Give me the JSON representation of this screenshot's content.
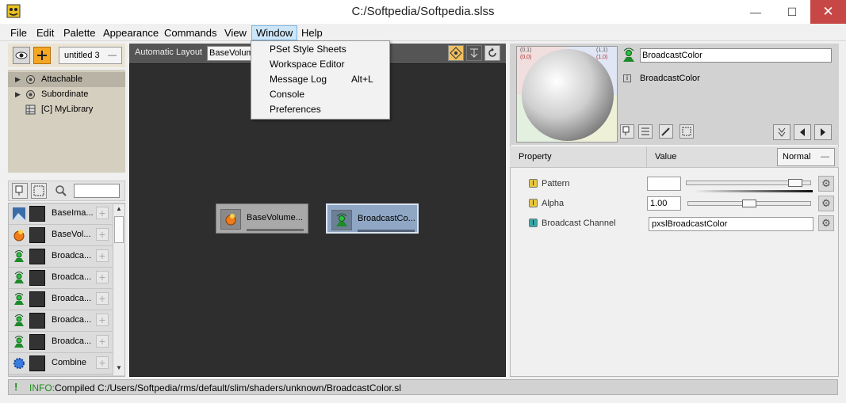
{
  "window": {
    "title": "C:/Softpedia/Softpedia.slss",
    "min_glyph": "—",
    "max_glyph": "☐",
    "close_glyph": "✕"
  },
  "menu": {
    "items": [
      "File",
      "Edit",
      "Palette",
      "Appearance",
      "Commands",
      "View",
      "Window",
      "Help"
    ],
    "active": "Window"
  },
  "window_menu": {
    "items": [
      {
        "label": "PSet Style Sheets",
        "shortcut": ""
      },
      {
        "label": "Workspace Editor",
        "shortcut": ""
      },
      {
        "label": "Message Log",
        "shortcut": "Alt+L"
      },
      {
        "label": "Console",
        "shortcut": ""
      },
      {
        "label": "Preferences",
        "shortcut": ""
      }
    ]
  },
  "left_panel": {
    "palette_select": "untitled 3",
    "tree": [
      {
        "label": "Attachable",
        "expandable": true,
        "selected": true
      },
      {
        "label": "Subordinate",
        "expandable": true,
        "selected": false
      },
      {
        "label": "[C] MyLibrary",
        "expandable": false,
        "selected": false
      }
    ],
    "search_value": "",
    "nodes": [
      {
        "label": "BaseIma...",
        "icon": "image-icon"
      },
      {
        "label": "BaseVol...",
        "icon": "volume-icon"
      },
      {
        "label": "Broadca...",
        "icon": "broadcast-icon"
      },
      {
        "label": "Broadca...",
        "icon": "broadcast-icon"
      },
      {
        "label": "Broadca...",
        "icon": "broadcast-icon"
      },
      {
        "label": "Broadca...",
        "icon": "broadcast-icon"
      },
      {
        "label": "Broadca...",
        "icon": "broadcast-icon"
      },
      {
        "label": "Combine",
        "icon": "combine-icon"
      }
    ]
  },
  "canvas": {
    "layout_label": "Automatic Layout",
    "layout_select": "BaseVolum",
    "nodes": [
      {
        "label": "BaseVolume...",
        "selected": false
      },
      {
        "label": "BroadcastCo...",
        "selected": true
      }
    ]
  },
  "right_panel": {
    "node_name": "BroadcastColor",
    "node_info": "BroadcastColor",
    "preview_corners": [
      "(0,1)",
      "(1,1)",
      "(0,0)",
      "(1,0)"
    ],
    "header": {
      "property": "Property",
      "value": "Value",
      "mode": "Normal"
    },
    "properties": [
      {
        "label": "Pattern",
        "badge": "I",
        "badge_color": "#e8c840",
        "value": "",
        "slider": 0.93
      },
      {
        "label": "Alpha",
        "badge": "I",
        "badge_color": "#e8c840",
        "value": "1.00",
        "slider": 0.5
      },
      {
        "label": "Broadcast Channel",
        "badge": "I",
        "badge_color": "#3aa6a6",
        "value": "pxslBroadcastColor",
        "slider": null
      }
    ]
  },
  "status": {
    "prefix": "INFO:",
    "message": "Compiled C:/Users/Softpedia/rms/default/slim/shaders/unknown/BroadcastColor.sl"
  },
  "colors": {
    "canvas_bg": "#2e2e2e",
    "selected_node": "#4f83c5",
    "status_prefix": "#1a8a1a"
  }
}
